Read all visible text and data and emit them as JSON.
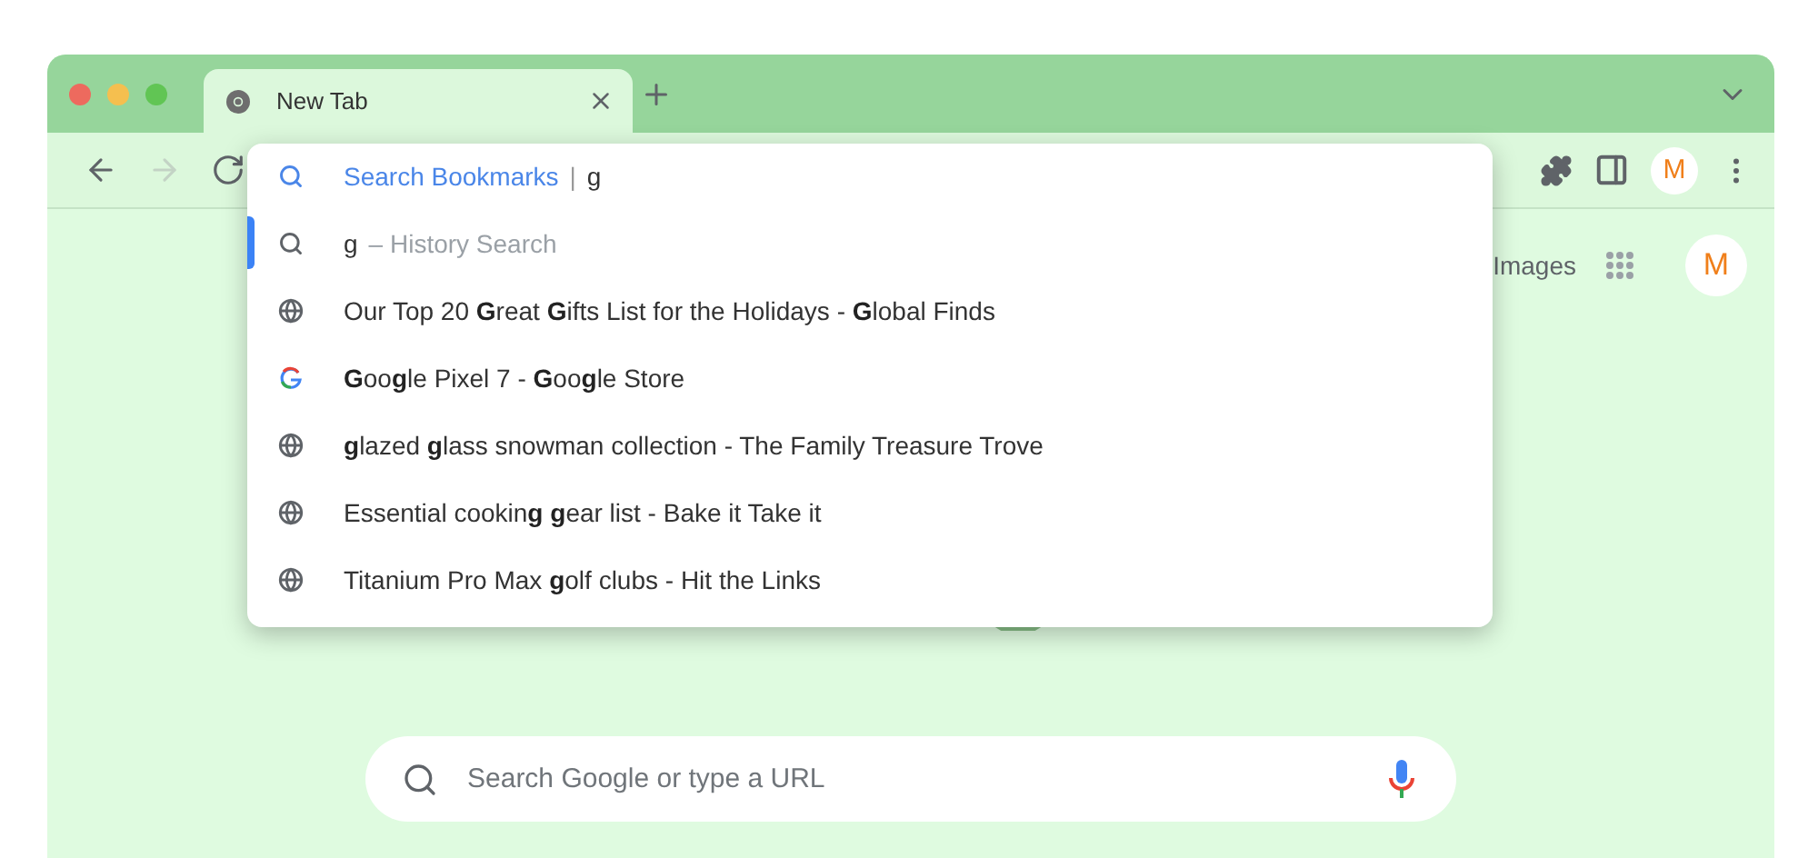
{
  "tabs": [
    {
      "title": "New Tab",
      "selected": true
    }
  ],
  "toolbar": {
    "nav": [
      {
        "kind": "back",
        "disabled": false
      },
      {
        "kind": "forward",
        "disabled": true
      },
      {
        "kind": "reload",
        "disabled": false
      }
    ],
    "avatar": "M"
  },
  "suggestions": [
    {
      "kind": "bookmarks",
      "label": "Search Bookmarks",
      "separator": "|",
      "query": "g",
      "selected": false
    },
    {
      "kind": "history",
      "query": "g",
      "label": "– History Search",
      "selected": true
    },
    {
      "kind": "site",
      "text": "Our Top 20 **G**reat **G**ifts List for the Holidays  - **G**lobal Finds",
      "selected": false
    },
    {
      "kind": "google",
      "text": "**G**oo**g**le Pixel 7 - **G**oo**g**le Store",
      "selected": false
    },
    {
      "kind": "site",
      "text": "**g**lazed **g**lass snowman collection - The Family Treasure Trove",
      "selected": false
    },
    {
      "kind": "site",
      "text": "Essential cookin**g** **g**ear list - Bake it Take it",
      "selected": false
    },
    {
      "kind": "site",
      "text": "Titanium Pro Max **g**olf clubs - Hit the Links",
      "selected": false
    }
  ],
  "page": {
    "images_link": "Images",
    "avatar": "M",
    "search": {
      "placeholder": "Search Google or type a URL"
    }
  }
}
